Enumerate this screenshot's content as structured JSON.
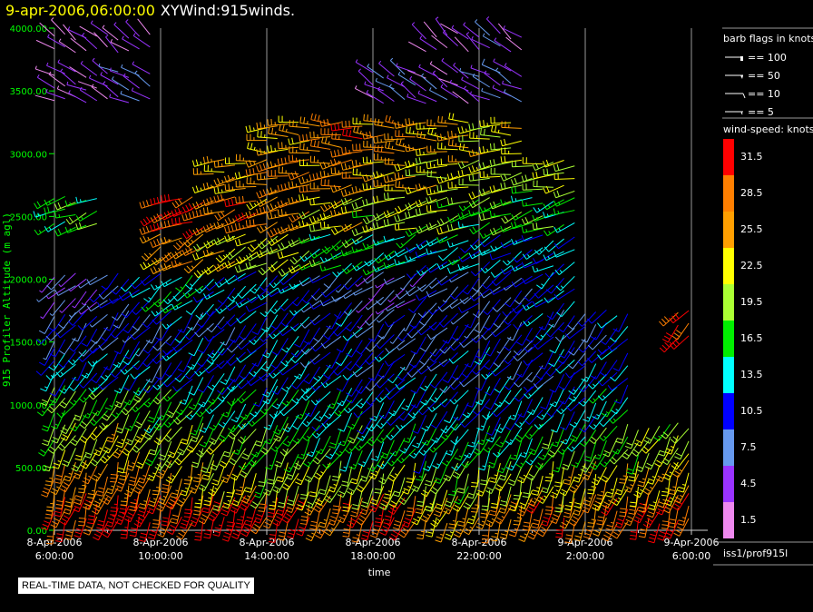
{
  "title": {
    "date": "9-apr-2006,06:00:00",
    "name": "XYWind:915winds."
  },
  "footer": {
    "quality_note": "REAL-TIME DATA, NOT CHECKED FOR QUALITY",
    "source": "iss1/prof915l"
  },
  "legend": {
    "barb_title": "barb flags in knots",
    "barbs": [
      {
        "label": "== 100"
      },
      {
        "label": "== 50"
      },
      {
        "label": "== 10"
      },
      {
        "label": "== 5"
      }
    ],
    "colorbar_title": "wind-speed: knots",
    "bins": [
      {
        "label": "31.5",
        "color": "#ff0000"
      },
      {
        "label": "28.5",
        "color": "#ff7f00"
      },
      {
        "label": "25.5",
        "color": "#ff9f00"
      },
      {
        "label": "22.5",
        "color": "#ffff00"
      },
      {
        "label": "19.5",
        "color": "#aaff33"
      },
      {
        "label": "16.5",
        "color": "#00ee00"
      },
      {
        "label": "13.5",
        "color": "#00ffff"
      },
      {
        "label": "10.5",
        "color": "#0000ff"
      },
      {
        "label": "7.5",
        "color": "#6699ee"
      },
      {
        "label": "4.5",
        "color": "#9933ff"
      },
      {
        "label": "1.5",
        "color": "#ee88ee"
      }
    ]
  },
  "chart_data": {
    "type": "wind-barb",
    "xlabel": "time",
    "ylabel": "915 Profiler Altitude (m agl)",
    "xlim": [
      "8-Apr-2006 6:00:00",
      "9-Apr-2006 6:00:00"
    ],
    "ylim": [
      0,
      4000
    ],
    "xticks": [
      {
        "d": "8-Apr-2006",
        "t": "6:00:00"
      },
      {
        "d": "8-Apr-2006",
        "t": "10:00:00"
      },
      {
        "d": "8-Apr-2006",
        "t": "14:00:00"
      },
      {
        "d": "8-Apr-2006",
        "t": "18:00:00"
      },
      {
        "d": "8-Apr-2006",
        "t": "22:00:00"
      },
      {
        "d": "9-Apr-2006",
        "t": "2:00:00"
      },
      {
        "d": "9-Apr-2006",
        "t": "6:00:00"
      }
    ],
    "yticks": [
      "0.00",
      "500.00",
      "1000.00",
      "1500.00",
      "2000.00",
      "2500.00",
      "3000.00",
      "3500.00",
      "4000.00"
    ],
    "grid": "vertical",
    "profiles_hours_since_start": [
      0,
      2,
      4,
      6,
      8,
      10,
      12,
      14,
      16,
      18,
      20,
      22,
      23.5
    ],
    "levels_m": [
      150,
      400,
      700,
      1000,
      1300,
      1600,
      1900,
      2200,
      2500,
      2800,
      3100,
      3500,
      3900
    ],
    "speed_knots": [
      [
        30,
        26,
        20,
        17,
        12,
        9,
        5,
        null,
        16,
        null,
        null,
        3,
        2
      ],
      [
        32,
        27,
        22,
        18,
        12,
        9,
        10,
        null,
        null,
        null,
        null,
        5,
        3
      ],
      [
        30,
        25,
        20,
        16,
        11,
        10,
        14,
        26,
        30,
        null,
        null,
        null,
        null
      ],
      [
        32,
        22,
        19,
        15,
        11,
        10,
        12,
        22,
        28,
        24,
        null,
        null,
        null
      ],
      [
        30,
        20,
        17,
        14,
        12,
        11,
        12,
        20,
        26,
        27,
        24,
        null,
        null
      ],
      [
        28,
        20,
        16,
        13,
        11,
        10,
        8,
        16,
        22,
        26,
        28,
        null,
        null
      ],
      [
        30,
        21,
        15,
        12,
        10,
        8,
        6,
        14,
        20,
        24,
        26,
        5,
        null
      ],
      [
        24,
        19,
        14,
        12,
        10,
        9,
        8,
        13,
        19,
        22,
        24,
        4,
        3
      ],
      [
        26,
        20,
        15,
        12,
        10,
        9,
        9,
        12,
        17,
        20,
        22,
        5,
        4
      ],
      [
        28,
        22,
        16,
        12,
        10,
        10,
        11,
        12,
        16,
        20,
        null,
        null,
        null
      ],
      [
        28,
        23,
        17,
        13,
        11,
        10,
        null,
        null,
        null,
        null,
        null,
        null,
        null
      ],
      [
        30,
        24,
        19,
        null,
        null,
        null,
        null,
        null,
        null,
        null,
        null,
        null,
        null
      ],
      [
        29,
        24,
        20,
        null,
        null,
        30,
        null,
        null,
        null,
        null,
        null,
        null,
        null
      ]
    ],
    "direction_deg": [
      200,
      200,
      210,
      215,
      220,
      220,
      230,
      240,
      250,
      260,
      270,
      300,
      310
    ]
  }
}
